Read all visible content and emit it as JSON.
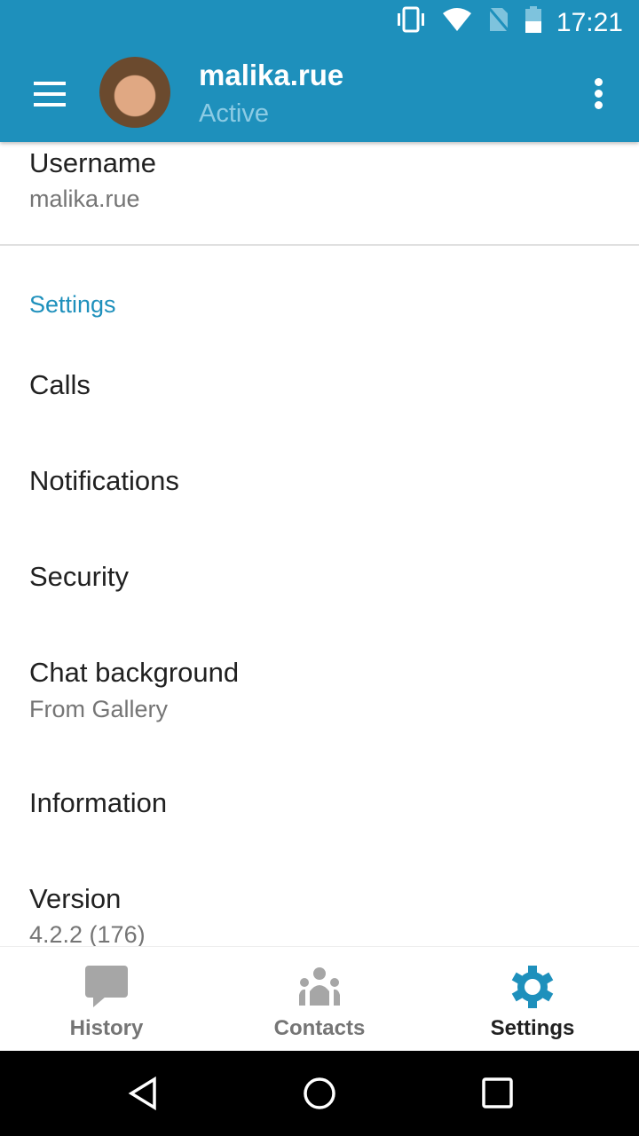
{
  "status_bar": {
    "time": "17:21",
    "icons": [
      "vibrate-icon",
      "wifi-icon",
      "no-sim-icon",
      "battery-icon"
    ]
  },
  "header": {
    "title": "malika.rue",
    "subtitle": "Active"
  },
  "profile": {
    "username_label": "Username",
    "username_value": "malika.rue"
  },
  "settings": {
    "section_title": "Settings",
    "items": [
      {
        "label": "Calls"
      },
      {
        "label": "Notifications"
      },
      {
        "label": "Security"
      },
      {
        "label": "Chat background",
        "value": "From Gallery"
      },
      {
        "label": "Information"
      },
      {
        "label": "Version",
        "value": "4.2.2 (176)"
      }
    ]
  },
  "bottom_nav": {
    "tabs": [
      {
        "label": "History"
      },
      {
        "label": "Contacts"
      },
      {
        "label": "Settings",
        "active": true
      }
    ]
  },
  "colors": {
    "accent": "#1e90bc",
    "inactive": "#9e9e9e"
  }
}
